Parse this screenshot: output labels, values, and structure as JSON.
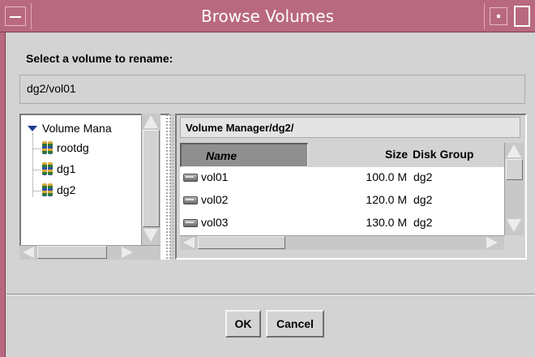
{
  "window": {
    "title": "Browse Volumes",
    "titlebar_color": "#b9697f"
  },
  "dialog": {
    "prompt": "Select a volume to rename:",
    "selected_volume": "dg2/vol01"
  },
  "tree": {
    "root_label": "Volume Mana",
    "root_icon": "expanded-triangle-icon",
    "items": [
      {
        "label": "rootdg",
        "icon": "disk-group-icon"
      },
      {
        "label": "dg1",
        "icon": "disk-group-icon"
      },
      {
        "label": "dg2",
        "icon": "disk-group-icon"
      }
    ]
  },
  "table": {
    "path": "Volume Manager/dg2/",
    "columns": [
      "Name",
      "Size",
      "Disk Group"
    ],
    "rows": [
      {
        "name": "vol01",
        "size": "100.0 M",
        "disk_group": "dg2",
        "icon": "volume-icon"
      },
      {
        "name": "vol02",
        "size": "120.0 M",
        "disk_group": "dg2",
        "icon": "volume-icon"
      },
      {
        "name": "vol03",
        "size": "130.0 M",
        "disk_group": "dg2",
        "icon": "volume-icon"
      }
    ]
  },
  "buttons": {
    "ok": "OK",
    "cancel": "Cancel"
  }
}
